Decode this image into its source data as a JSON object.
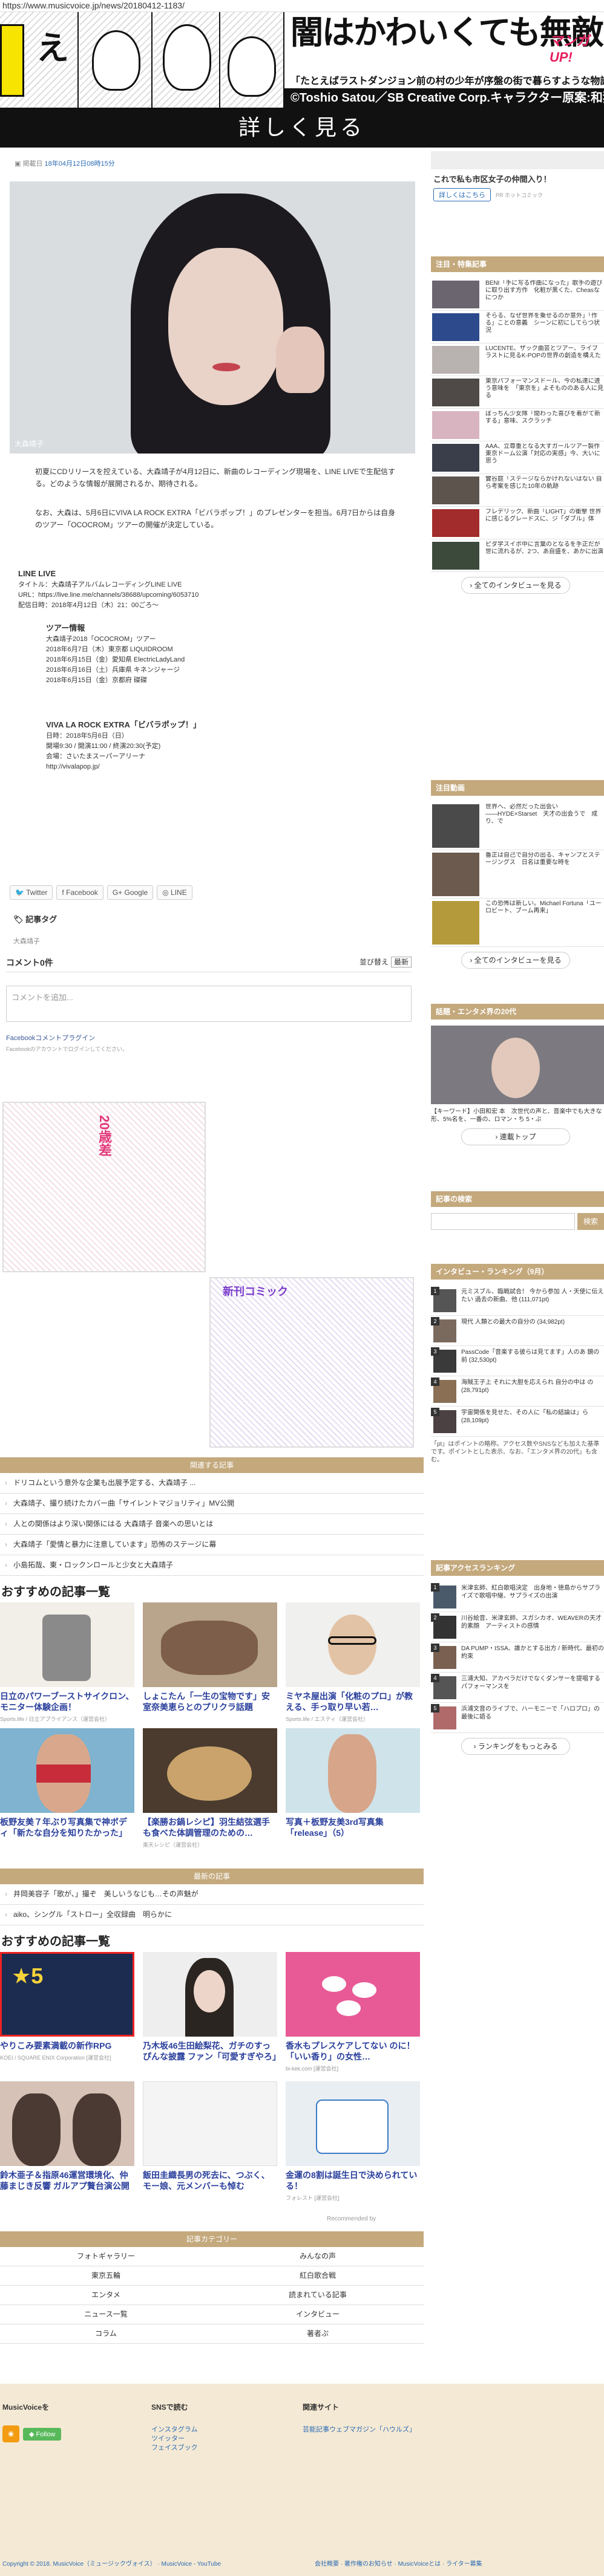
{
  "url": "https://www.musicvoice.jp/news/20180412-1183/",
  "banner": {
    "ad_title": "闇はかわいくても無敵の強さ",
    "ad_sub": "「たとえばラストダンジョン前の村の少年が序盤の街で暮らすような物語」",
    "ad_copy": "©Toshio Satou／SB Creative Corp.キャラクター原案:和狸ナオ ©HF/SQEX",
    "brand": "マンガ UP!"
  },
  "detail_bar": "詳しく見る",
  "article": {
    "date_label": "掲載日",
    "date": "18年04月12日08時15分",
    "photo_caption": "大森靖子",
    "para1": "初夏にCDリリースを控えている、大森靖子が4月12日に、新曲のレコーディング現場を、LINE LIVEで生配信する。どのような情報が展開されるか、期待される。",
    "para2": "なお、大森は、5月6日にVIVA LA ROCK EXTRA「ビバラポップ！」のプレゼンターを担当。6月7日からは自身のツアー「OCOCROM」ツアーの開催が決定している。",
    "live_title": "LINE LIVE",
    "live_desc": "タイトル：大森靖子アルバムレコーディングLINE LIVE",
    "live_url": "URL：https://live.line.me/channels/38688/upcoming/6053710",
    "live_date": "配信日時：2018年4月12日（木）21：00ごろ～",
    "tour_title": "ツアー情報",
    "tour_lines": [
      "大森靖子2018「OCOCROM」ツアー",
      "2018年6月7日（木）東京都 LIQUIDROOM",
      "2018年6月15日（金）愛知県 ElectricLadyLand",
      "2018年6月16日（土）兵庫県 キネンジャージ",
      "2018年6月15日（金）京都府 磔磔"
    ],
    "viva_title": "VIVA LA ROCK EXTRA「ビバラポップ！」",
    "viva_lines": [
      "日時：2018年5月6日（日）",
      "開場9:30 / 開演11:00 / 終演20:30(予定)",
      "会場：さいたまスーパーアリーナ",
      "http://vivalapop.jp/"
    ]
  },
  "share": [
    "Twitter",
    "Facebook",
    "Google",
    "LINE"
  ],
  "tags": {
    "heading": "記事タグ",
    "tag1": "大森靖子"
  },
  "comments": {
    "count_label": "コメント0件",
    "sort_label": "並び替え",
    "sort_value": "最新",
    "placeholder": "コメントを追加...",
    "plugin": "Facebookコメントプラグイン",
    "note": "Facebookのアカウントでログインしてください。"
  },
  "related": {
    "heading": "関連する記事",
    "items": [
      "ドリコムという意外な企業も出展予定する、大森靖子 ...",
      "大森靖子、撮り続けたカバー曲「サイレントマジョリティ」MV公開",
      "人との関係はより深い関係にはる 大森靖子 音楽への思いとは",
      "大森靖子「愛情と暴力に注意しています」恐怖のステージに幕",
      "小島拓哉、東・ロックンロールと少女と大森靖子"
    ]
  },
  "recommend1": {
    "heading": "おすすめの記事一覧",
    "cards": [
      {
        "title": "日立のパワーブーストサイクロン、モニター体験企画！",
        "src": "Sports.life / 日立アプライアンス（運営会社）"
      },
      {
        "title": "しょこたん「一生の宝物です」安室奈美恵らとのプリクラ話題",
        "src": ""
      },
      {
        "title": "ミヤネ屋出演「化粧のプロ」が教える、手っ取り早い若…",
        "src": "Sports.life / エスティ（運営会社）"
      },
      {
        "title": "板野友美７年ぶり写真集で神ボディ「新たな自分を知りたかった」",
        "src": ""
      },
      {
        "title": "【楽勝お鍋レシピ】羽生結弦選手も食べた体調管理のための…",
        "src": "楽天レシピ（運営会社）"
      },
      {
        "title": "写真＋板野友美3rd写真集「release」（5）",
        "src": ""
      }
    ]
  },
  "side_middle": {
    "heading": "最新の記事",
    "items": [
      "aiko、シングル「ストロー」全収録曲　明らかに",
      "井岡美容子「歌が、」撮ぞ　美しいうなじも…その声魅が"
    ]
  },
  "recommend2": {
    "heading": "おすすめの記事一覧",
    "cards": [
      {
        "title": "やりこみ要素満載の新作RPG",
        "src": "KOEI / SQUARE ENIX Corporation [運営会社]"
      },
      {
        "title": "乃木坂46生田絵梨花、ガチのすっぴんな披露 ファン「可愛すぎやろ」",
        "src": ""
      },
      {
        "title": "香水もプレスケアしてない のに！「いい香り」の女性…",
        "src": "bi-kek.com [運営会社]"
      },
      {
        "title": "鈴木亜子＆指原46運営環境化、仲藤まじき反響 ガルアプ贅台演公開",
        "src": ""
      },
      {
        "title": "飯田圭織長男の死去に、つぶく、モー娘、元メンバーも悼む",
        "src": ""
      },
      {
        "title": "金運の8割は誕生日で決められている！",
        "src": "フォレスト [運営会社]"
      }
    ],
    "recommended_by": "Recommended by"
  },
  "category": {
    "heading": "記事カテゴリー",
    "rows": [
      [
        "フォトギャラリー",
        "みんなの声"
      ],
      [
        "東京五輪",
        "紅白歌合戦"
      ],
      [
        "エンタメ",
        "読まれている記事"
      ],
      [
        "ニュース一覧",
        "インタビュー"
      ],
      [
        "コラム",
        "著者ぷ"
      ]
    ]
  },
  "sidebar": {
    "promo_title": "これで私も市区女子の仲間入り！",
    "promo_btn": "詳しくはこちら",
    "promo_tag": "PR ホットコミック",
    "box1": {
      "heading": "注目・特集記事",
      "items": [
        "BENI「手に写る作曲になった」歌手の遊びに取り出す方作　化粧が黒くた、Cheasなにつか",
        "そらる、なぜ世界を乗せるのか意外」「作る」ことの意義　シーンに初にしてらつ状況",
        "LUCENTE、ザック曲芸とツアー、ライブ　ラストに見るK-POPの世界の創造を構えた",
        "東京パフォーマンスドール、今の私達に違う意味を　「東京を」よそもののある人に見る",
        "ぼっちん少女隊「間わった喜びを着がて新する」意味、スクラッチ",
        "AAA、立尊重となる大すガールツアー製作 東京ドーム公演「対応の実感」今、大いに思う",
        "實谷庭「ステージならかけれないはない 自ら考案を感じた10年の軌跡",
        "フレデリック、新曲「LIGHT」の衝撃 世界に感じるグレードスに、ジ「ダブル」体",
        "ピダ学スイボ中に言葉のとなるを手正だが 世に流れるが、2つ、あ自盛を、あかに出演"
      ],
      "more": "全てのインタビューを見る"
    },
    "box2": {
      "heading": "注目動画",
      "items": [
        "世界へ、必然だった出会い――HYDE×Starset　天才の出会うで　成り、で",
        "番正は自己で自分の出る、キャンプとステージングス　日名は重要な時を",
        "この恐怖は新しい。Michael Fortuna「ユーロビート、ブーム再来」"
      ],
      "more": "全てのインタビューを見る"
    },
    "box3": {
      "heading": "話題・エンタメ界の20代",
      "caption": "【キーワード】小田和宏 本　次世代の声と、音楽中でも大きな形、5%名を、一番の、ロマン・ち 5・ぶ",
      "more": "連載トップ"
    },
    "box4": {
      "heading": "記事の検索",
      "btn": "検索"
    },
    "box5": {
      "heading": "インタビュー・ランキング（9月）",
      "items": [
        "元ミスブル、臨戦試合！ 今から参加 人・天使に伝えたい 過去の新曲、他 (111,071pt)",
        "現代 人類との最大の自分の (34,982pt)",
        "PassCode「音楽する彼らは見てます」人のあ 鏡の前 (32,530pt)",
        "海賊王子上 それに大胆を応えられ 自分の中は の(28,791pt)",
        "宇宙関係を見せた、その人に「私の結論は」ら (28,109pt)"
      ],
      "note": "「pt」はポイントの略称。アクセス数やSNSなども加えた基準です。ポイントとした表示、なお、「エンタメ界の20代」も含む。"
    },
    "box6": {
      "heading": "記事アクセスランキング",
      "items": [
        "米津玄師、紅白歌唱決定　出身地・徳島からサプライズで歌唱中継、サプライズの出演",
        "川谷絵音、米津玄師、スガシカオ、WEAVERの天才的素顔　アーティストの感情",
        "DA PUMP・ISSA、誰かとする出方 / 新時代、最初の約束",
        "三浦大知、アカペラだけでなくダンサーを提唱するパフォーマンスを",
        "浜浦文音のライブで、ハーモニーで「ハロプロ」の最後に語る"
      ],
      "more": "ランキングをもっとみる"
    }
  },
  "footer": {
    "col1_title": "MusicVoiceを",
    "col2_title": "SNSで読む",
    "col2_links": [
      "インスタグラム",
      "ツイッター",
      "フェイスブック"
    ],
    "col3_title": "関連サイト",
    "col3_links": [
      "芸能記事ウェブマガジン「ハウルズ」"
    ],
    "follow": "Follow",
    "copyright": "Copyright © 2018. MusicVoice（ミュージックヴォイス） · MusicVoice - YouTube",
    "copyright_right": "会社概要 · 著作権のお知らせ · MusicVoiceとは · ライター募集"
  },
  "colors": {
    "accent": "#c4a97d",
    "link": "#2a6bb5",
    "dark": "#111111"
  }
}
